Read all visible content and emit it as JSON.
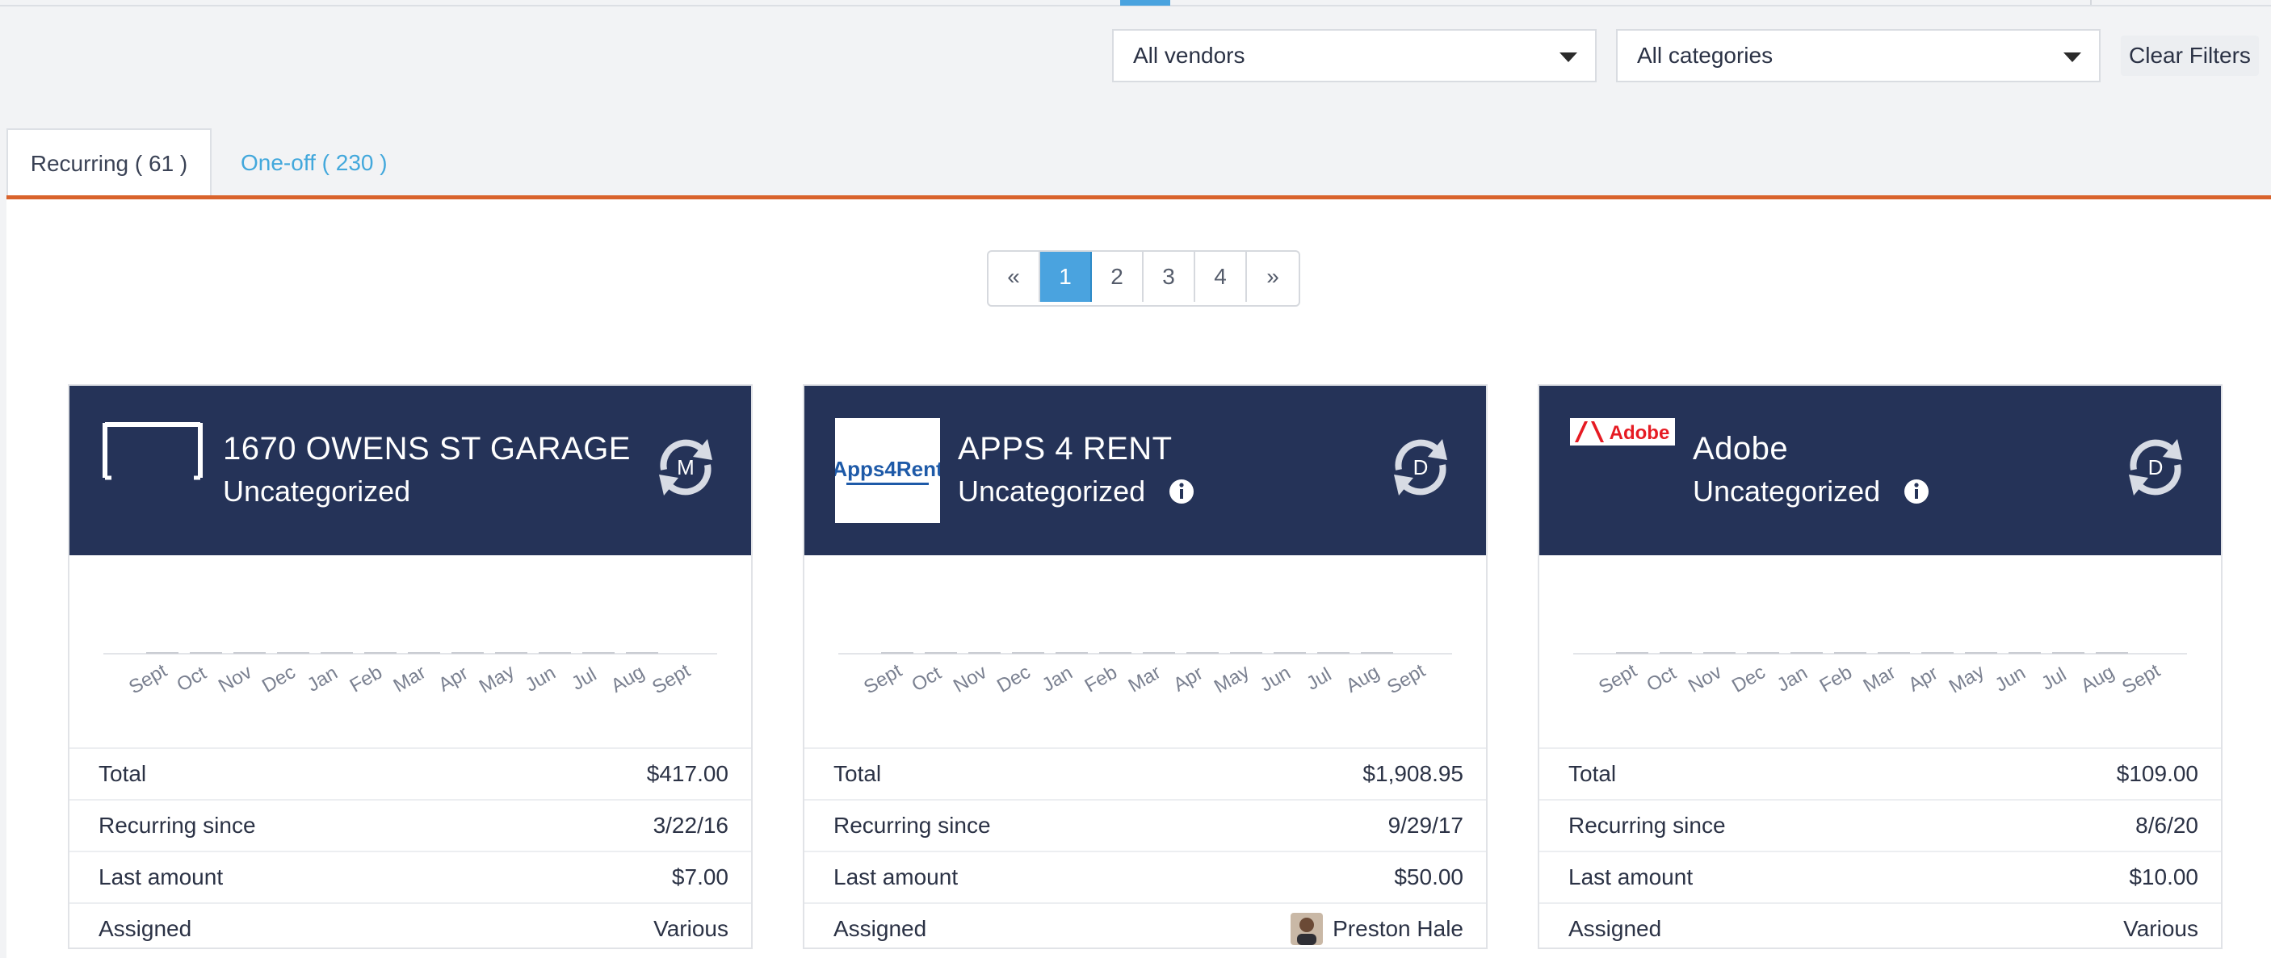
{
  "filters": {
    "vendor_select": "All vendors",
    "category_select": "All categories",
    "clear_label": "Clear Filters"
  },
  "tabs": [
    {
      "label": "Recurring ( 61 )",
      "active": true
    },
    {
      "label": "One-off ( 230 )",
      "active": false
    }
  ],
  "pagination": {
    "prev": "«",
    "pages": [
      "1",
      "2",
      "3",
      "4"
    ],
    "current": "1",
    "next": "»"
  },
  "colors": {
    "card_header": "#253358",
    "accent_blue": "#4aa3df",
    "tab_underline": "#d9632c"
  },
  "month_labels": [
    "Sept",
    "Oct",
    "Nov",
    "Dec",
    "Jan",
    "Feb",
    "Mar",
    "Apr",
    "May",
    "Jun",
    "Jul",
    "Aug",
    "Sept"
  ],
  "cards": [
    {
      "logo": "garage-bracket-logo",
      "name": "1670 OWENS ST GARAGE",
      "category": "Uncategorized",
      "show_info": false,
      "frequency_letter": "M",
      "frequency_icon": "refresh-cycle-icon",
      "rows": {
        "total_label": "Total",
        "total": "$417.00",
        "since_label": "Recurring since",
        "since": "3/22/16",
        "last_label": "Last amount",
        "last": "$7.00",
        "assigned_label": "Assigned",
        "assigned": "Various"
      }
    },
    {
      "logo": "apps4rent-logo",
      "logo_text": "Apps4Rent",
      "name": "APPS 4 RENT",
      "category": "Uncategorized",
      "show_info": true,
      "frequency_letter": "D",
      "frequency_icon": "refresh-cycle-icon",
      "rows": {
        "total_label": "Total",
        "total": "$1,908.95",
        "since_label": "Recurring since",
        "since": "9/29/17",
        "last_label": "Last amount",
        "last": "$50.00",
        "assigned_label": "Assigned",
        "assigned": "Preston Hale"
      }
    },
    {
      "logo": "adobe-logo",
      "logo_text": "Adobe",
      "name": "Adobe",
      "category": "Uncategorized",
      "show_info": true,
      "frequency_letter": "D",
      "frequency_icon": "refresh-cycle-icon",
      "rows": {
        "total_label": "Total",
        "total": "$109.00",
        "since_label": "Recurring since",
        "since": "8/6/20",
        "last_label": "Last amount",
        "last": "$10.00",
        "assigned_label": "Assigned",
        "assigned": "Various"
      }
    }
  ]
}
